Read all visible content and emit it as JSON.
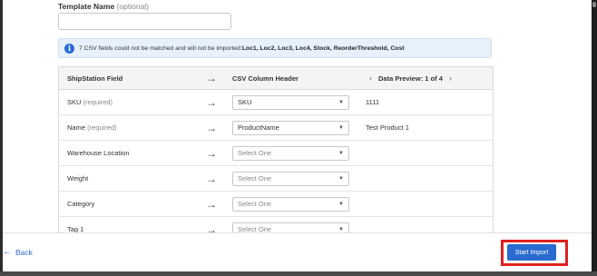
{
  "template": {
    "label": "Template Name",
    "optional": "(optional)",
    "value": ""
  },
  "info": {
    "icon": "info-icon",
    "message": "7 CSV fields could not be matched and will not be imported: ",
    "fields": "Loc1,  Loc2,  Loc3,  Loc4,  Stock,  ReorderThreshold,  Cost"
  },
  "table": {
    "headers": {
      "field": "ShipStation Field",
      "csv": "CSV Column Header",
      "preview": "Data Preview: 1 of 4"
    },
    "rows": [
      {
        "field": "SKU",
        "req": "(required)",
        "csv": "SKU",
        "preview": "1111"
      },
      {
        "field": "Name",
        "req": "(required)",
        "csv": "ProductName",
        "preview": "Test Product 1"
      },
      {
        "field": "Warehouse Location",
        "req": "",
        "csv": "Select One",
        "preview": ""
      },
      {
        "field": "Weight",
        "req": "",
        "csv": "Select One",
        "preview": ""
      },
      {
        "field": "Category",
        "req": "",
        "csv": "Select One",
        "preview": ""
      },
      {
        "field": "Tag 1",
        "req": "",
        "csv": "Select One",
        "preview": ""
      }
    ]
  },
  "footer": {
    "back_label": "Back",
    "start_label": "Start Import"
  },
  "colors": {
    "accent": "#2a6bd1",
    "highlight": "#e02020",
    "info_bg": "#e6f1fb"
  }
}
